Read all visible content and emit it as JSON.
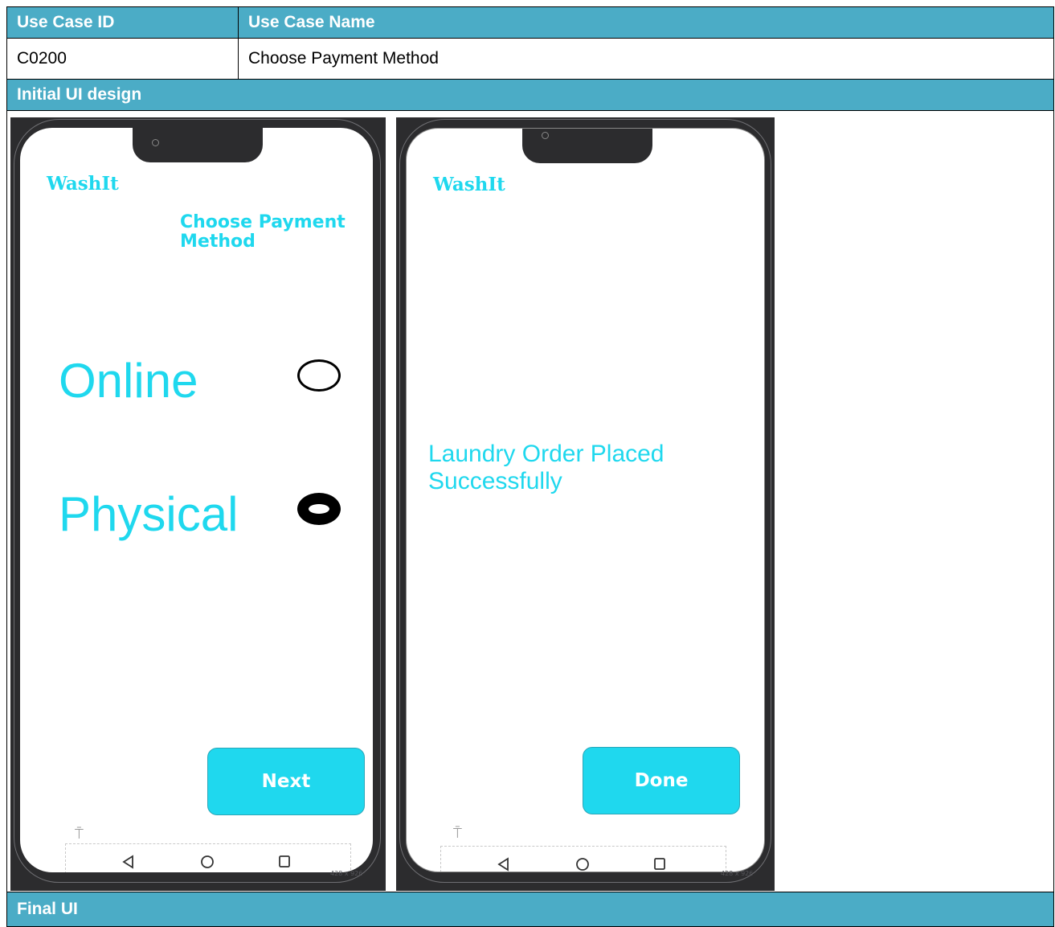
{
  "table": {
    "header": {
      "id_label": "Use Case ID",
      "name_label": "Use Case Name"
    },
    "row": {
      "id": "C0200",
      "name": "Choose Payment Method"
    },
    "initial_ui_label": "Initial UI design",
    "final_ui_label": "Final UI"
  },
  "mockup_1": {
    "brand": "WashIt",
    "title_line1": "Choose Payment",
    "title_line2": "Method",
    "option_online": "Online",
    "option_physical": "Physical",
    "selected_option": "Physical",
    "next_button": "Next",
    "size_label": "428 x 926"
  },
  "mockup_2": {
    "brand": "WashIt",
    "message_line1": "Laundry Order Placed",
    "message_line2": "Successfully",
    "done_button": "Done",
    "size_label": "428 x 926"
  },
  "colors": {
    "header_bg": "#4bacc6",
    "accent_cyan": "#1fd8ee",
    "device_bg": "#2c2c2e"
  },
  "icons": [
    "back-triangle-icon",
    "home-circle-icon",
    "recents-square-icon",
    "pin-icon",
    "radio-empty-icon",
    "radio-selected-icon"
  ]
}
